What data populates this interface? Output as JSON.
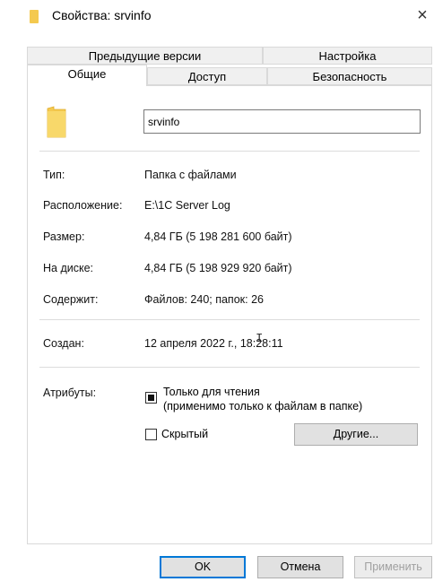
{
  "window": {
    "title": "Свойства: srvinfo",
    "close_glyph": "×"
  },
  "tabs": {
    "row_back": [
      "Предыдущие версии",
      "Настройка"
    ],
    "row_front": [
      "Общие",
      "Доступ",
      "Безопасность"
    ],
    "active": "Общие"
  },
  "general": {
    "name_value": "srvinfo",
    "rows": [
      {
        "label": "Тип:",
        "value": "Папка с файлами"
      },
      {
        "label": "Расположение:",
        "value": "E:\\1C Server Log"
      },
      {
        "label": "Размер:",
        "value": "4,84 ГБ (5 198 281 600 байт)"
      },
      {
        "label": "На диске:",
        "value": "4,84 ГБ (5 198 929 920 байт)"
      },
      {
        "label": "Содержит:",
        "value": "Файлов: 240; папок: 26"
      }
    ],
    "created": {
      "label": "Создан:",
      "value": "12 апреля 2022 г., 18:28:11"
    },
    "attributes": {
      "label": "Атрибуты:",
      "readonly_line1": "Только для чтения",
      "readonly_line2": "(применимо только к файлам в папке)",
      "readonly_state": "indeterminate",
      "hidden_label": "Скрытый",
      "hidden_state": "unchecked",
      "other_button": "Другие..."
    }
  },
  "footer": {
    "ok": "OK",
    "cancel": "Отмена",
    "apply": "Применить"
  },
  "colors": {
    "folder": "#f4c94f",
    "default_border": "#0078d7"
  }
}
